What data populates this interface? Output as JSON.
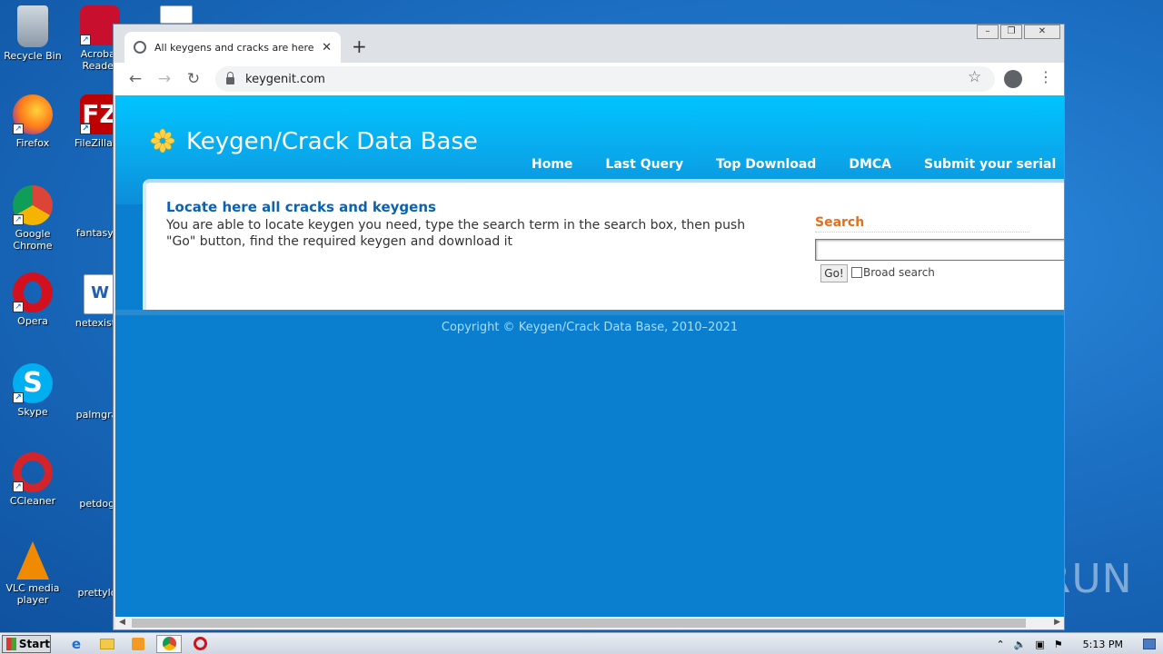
{
  "desktop": {
    "icons": [
      {
        "label": "Recycle Bin"
      },
      {
        "label": "Acrobat Reader"
      },
      {
        "label": "Firefox"
      },
      {
        "label": "FileZilla Cl"
      },
      {
        "label": "Google Chrome"
      },
      {
        "label": "fantasyth"
      },
      {
        "label": "Opera"
      },
      {
        "label": "netexistin"
      },
      {
        "label": "Skype"
      },
      {
        "label": "palmgrap"
      },
      {
        "label": "CCleaner"
      },
      {
        "label": "petdog.j"
      },
      {
        "label": "VLC media player"
      },
      {
        "label": "prettyloc"
      }
    ]
  },
  "browser": {
    "tab_title": "All keygens and cracks are here",
    "tab_close": "✕",
    "new_tab": "+",
    "url": "keygenit.com"
  },
  "page": {
    "site_title": "Keygen/Crack Data Base",
    "nav": [
      "Home",
      "Last Query",
      "Top Download",
      "DMCA",
      "Submit your serial"
    ],
    "heading": "Locate here all cracks and keygens",
    "description": "You are able to locate keygen you need, type the search term in the search box, then push \"Go\" button, find the required keygen and download it",
    "search_label": "Search",
    "search_value": "",
    "go_label": "Go!",
    "broad_label": "Broad search",
    "copyright": "Copyright © Keygen/Crack Data Base, 2010–2021"
  },
  "watermark": "ANY RUN",
  "taskbar": {
    "start_label": "Start",
    "clock": "5:13 PM"
  },
  "colors": {
    "header_top": "#00c4ff",
    "page_bg": "#0a7fcf",
    "heading": "#0a62b0",
    "search_label": "#e07020"
  }
}
